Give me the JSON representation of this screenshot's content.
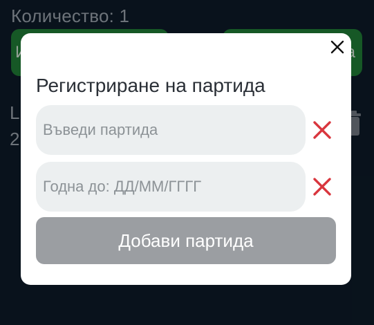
{
  "background": {
    "quantity_label": "Количество: 1",
    "left_button_initial": "И",
    "right_button_trailing": "а",
    "item_initial": "L",
    "item_digit": "2"
  },
  "modal": {
    "title": "Регистриране на партида",
    "batch_placeholder": "Въведи партида",
    "batch_value": "",
    "expiry_placeholder": "Годна до: ДД/ММ/ГГГГ",
    "expiry_value": "",
    "add_button_label": "Добави партида",
    "close_icon": "close-icon",
    "clear_icon": "clear-x-icon"
  },
  "colors": {
    "background": "#0d1a27",
    "bg_button": "#1f7a35",
    "clear_x": "#d9363e",
    "add_button_disabled": "#9b9ea2"
  }
}
